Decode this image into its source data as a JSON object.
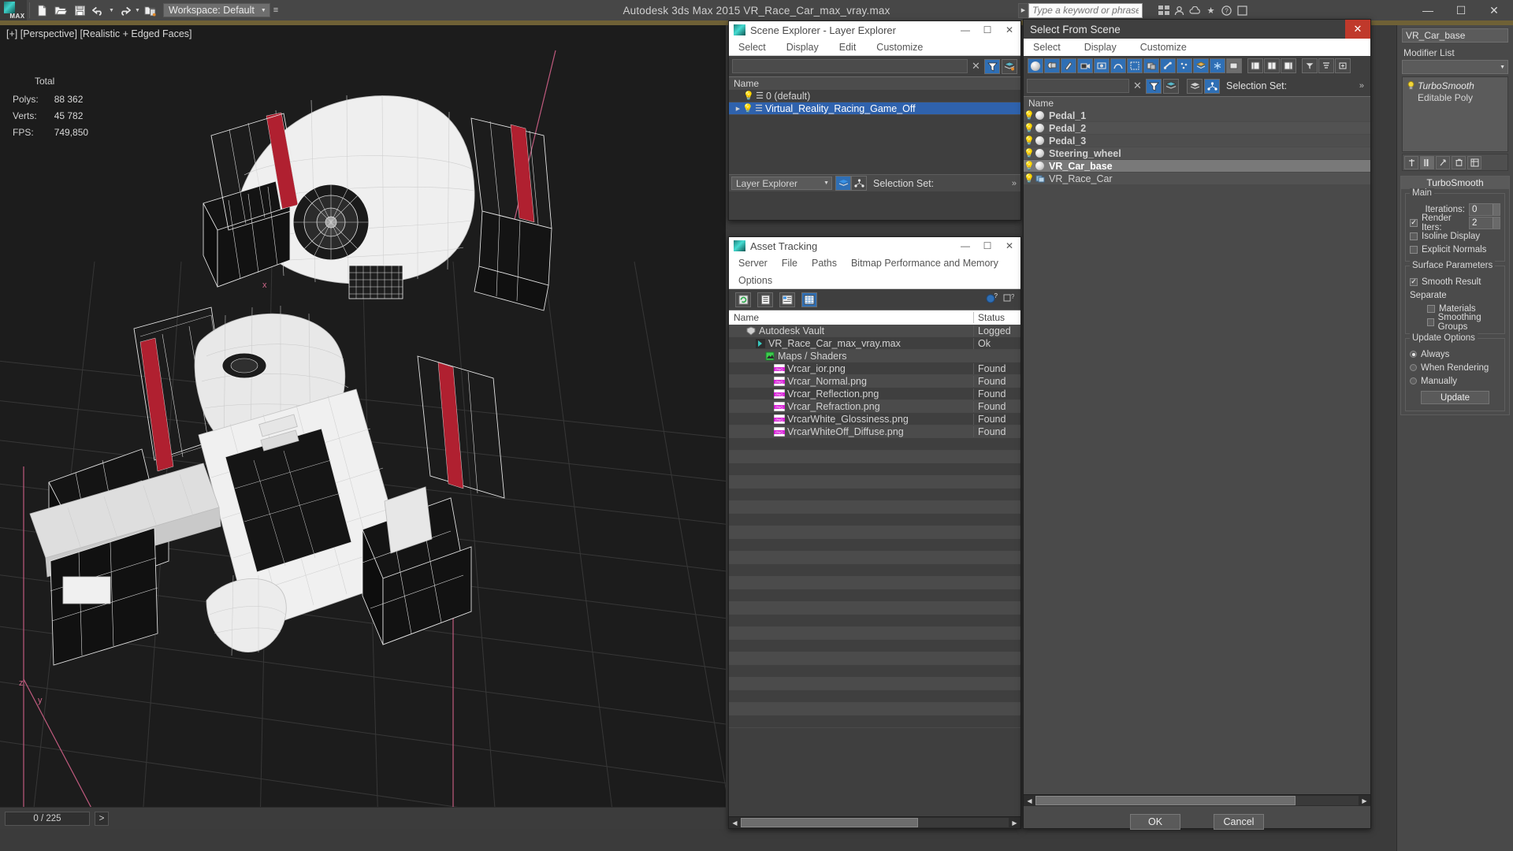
{
  "app": {
    "title": "Autodesk 3ds Max  2015     VR_Race_Car_max_vray.max",
    "workspace_label": "Workspace: Default",
    "search_placeholder": "Type a keyword or phrase",
    "logo_text": "MAX"
  },
  "window_controls": {
    "minimize": "—",
    "maximize": "☐",
    "close": "✕"
  },
  "viewport": {
    "label": "[+] [Perspective] [Realistic + Edged Faces]",
    "stats_title": "Total",
    "stats": [
      {
        "key": "Polys:",
        "value": "88 362"
      },
      {
        "key": "Verts:",
        "value": "45 782"
      },
      {
        "key": "FPS:",
        "value": "749,850"
      }
    ],
    "axis_z": "z",
    "axis_x": "x"
  },
  "statusbar": {
    "frame": "0 / 225",
    "next": ">"
  },
  "scene_explorer": {
    "title": "Scene Explorer - Layer Explorer",
    "menu": [
      "Select",
      "Display",
      "Edit",
      "Customize"
    ],
    "search_value": "",
    "column_name": "Name",
    "rows": [
      {
        "label": "0 (default)",
        "selected": false
      },
      {
        "label": "Virtual_Reality_Racing_Game_Off",
        "selected": true
      }
    ],
    "footer_tab": "Layer Explorer",
    "footer_selection_set": "Selection Set:"
  },
  "asset_tracking": {
    "title": "Asset Tracking",
    "menu": [
      "Server",
      "File",
      "Paths",
      "Bitmap Performance and Memory",
      "Options"
    ],
    "columns": {
      "name": "Name",
      "status": "Status"
    },
    "rows": [
      {
        "name": "Autodesk Vault",
        "status": "Logged",
        "icon": "vault-icon",
        "indent": 0
      },
      {
        "name": "VR_Race_Car_max_vray.max",
        "status": "Ok",
        "icon": "max-file-icon",
        "indent": 1
      },
      {
        "name": "Maps / Shaders",
        "status": "",
        "icon": "maps-icon",
        "indent": 2
      },
      {
        "name": "Vrcar_ior.png",
        "status": "Found",
        "icon": "png-icon",
        "indent": 3
      },
      {
        "name": "Vrcar_Normal.png",
        "status": "Found",
        "icon": "png-icon",
        "indent": 3
      },
      {
        "name": "Vrcar_Reflection.png",
        "status": "Found",
        "icon": "png-icon",
        "indent": 3
      },
      {
        "name": "Vrcar_Refraction.png",
        "status": "Found",
        "icon": "png-icon",
        "indent": 3
      },
      {
        "name": "VrcarWhite_Glossiness.png",
        "status": "Found",
        "icon": "png-icon",
        "indent": 3
      },
      {
        "name": "VrcarWhiteOff_Diffuse.png",
        "status": "Found",
        "icon": "png-icon",
        "indent": 3
      }
    ]
  },
  "select_from_scene": {
    "title": "Select From Scene",
    "menu": [
      "Select",
      "Display",
      "Customize"
    ],
    "search_value": "",
    "selection_set_label": "Selection Set:",
    "column_name": "Name",
    "rows": [
      {
        "label": "Pedal_1",
        "selected": false,
        "bold": true
      },
      {
        "label": "Pedal_2",
        "selected": false,
        "bold": true
      },
      {
        "label": "Pedal_3",
        "selected": false,
        "bold": true
      },
      {
        "label": "Steering_wheel",
        "selected": false,
        "bold": true
      },
      {
        "label": "VR_Car_base",
        "selected": true,
        "bold": true
      },
      {
        "label": "VR_Race_Car",
        "selected": false,
        "bold": false
      }
    ],
    "ok_label": "OK",
    "cancel_label": "Cancel"
  },
  "command_panel": {
    "object_name": "VR_Car_base",
    "modifier_list_label": "Modifier List",
    "stack": [
      {
        "label": "TurboSmooth",
        "selected": true
      },
      {
        "label": "Editable Poly",
        "selected": false
      }
    ],
    "rollout_title": "TurboSmooth",
    "main_group": "Main",
    "iterations_label": "Iterations:",
    "iterations_value": "0",
    "render_iters_label": "Render Iters:",
    "render_iters_value": "2",
    "render_iters_checked": true,
    "isoline_label": "Isoline Display",
    "isoline_checked": false,
    "explicit_normals_label": "Explicit Normals",
    "explicit_normals_checked": false,
    "surface_group": "Surface Parameters",
    "smooth_result_label": "Smooth Result",
    "smooth_result_checked": true,
    "separate_label": "Separate",
    "materials_label": "Materials",
    "materials_checked": false,
    "smoothing_groups_label": "Smoothing Groups",
    "smoothing_groups_checked": false,
    "update_group": "Update Options",
    "update_options": [
      {
        "label": "Always",
        "checked": true
      },
      {
        "label": "When Rendering",
        "checked": false
      },
      {
        "label": "Manually",
        "checked": false
      }
    ],
    "update_button": "Update"
  },
  "colors": {
    "accent_blue": "#2f62ad",
    "viewport_bg": "#1c1c1c",
    "panel_bg": "#494949",
    "stripe_red": "#b02030",
    "menu_strip": "#6f6136"
  }
}
